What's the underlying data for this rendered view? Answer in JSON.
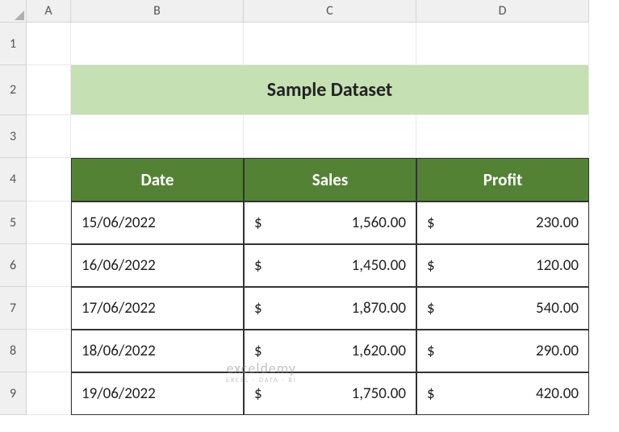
{
  "columns": [
    "A",
    "B",
    "C",
    "D"
  ],
  "rows": [
    "1",
    "2",
    "3",
    "4",
    "5",
    "6",
    "7",
    "8",
    "9"
  ],
  "title": "Sample Dataset",
  "table": {
    "headers": {
      "date": "Date",
      "sales": "Sales",
      "profit": "Profit"
    },
    "currency": "$",
    "data": [
      {
        "date": "15/06/2022",
        "sales": "1,560.00",
        "profit": "230.00"
      },
      {
        "date": "16/06/2022",
        "sales": "1,450.00",
        "profit": "120.00"
      },
      {
        "date": "17/06/2022",
        "sales": "1,870.00",
        "profit": "540.00"
      },
      {
        "date": "18/06/2022",
        "sales": "1,620.00",
        "profit": "290.00"
      },
      {
        "date": "19/06/2022",
        "sales": "1,750.00",
        "profit": "420.00"
      }
    ]
  },
  "watermark": {
    "main": "exceldemy",
    "sub": "EXCEL · DATA · BI"
  },
  "chart_data": {
    "type": "table",
    "title": "Sample Dataset",
    "columns": [
      "Date",
      "Sales",
      "Profit"
    ],
    "rows": [
      [
        "15/06/2022",
        1560.0,
        230.0
      ],
      [
        "16/06/2022",
        1450.0,
        120.0
      ],
      [
        "17/06/2022",
        1870.0,
        540.0
      ],
      [
        "18/06/2022",
        1620.0,
        290.0
      ],
      [
        "19/06/2022",
        1750.0,
        420.0
      ]
    ],
    "currency": "$"
  }
}
